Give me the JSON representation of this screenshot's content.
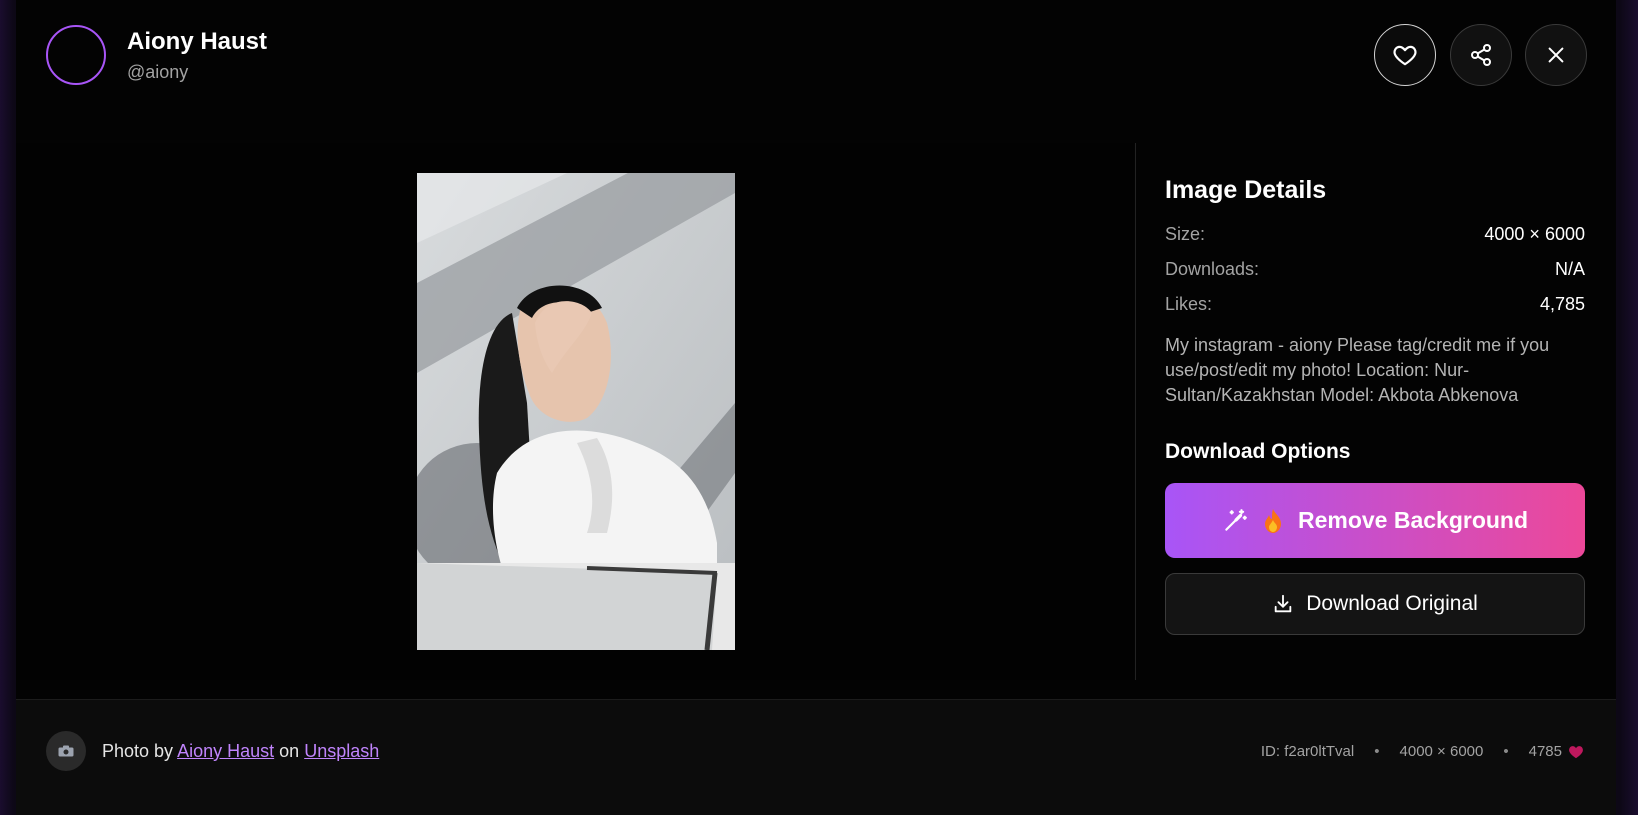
{
  "author": {
    "name": "Aiony Haust",
    "handle": "@aiony"
  },
  "details": {
    "title": "Image Details",
    "rows": [
      {
        "label": "Size:",
        "value": "4000 × 6000"
      },
      {
        "label": "Downloads:",
        "value": "N/A"
      },
      {
        "label": "Likes:",
        "value": "4,785"
      }
    ],
    "description": "My instagram - aiony Please tag/credit me if you use/post/edit my photo! Location: Nur-Sultan/Kazakhstan Model: Akbota Abkenova"
  },
  "download": {
    "title": "Download Options",
    "remove_bg_label": "Remove Background",
    "original_label": "Download Original"
  },
  "footer": {
    "photo_by": "Photo by",
    "author_link": "Aiony Haust",
    "on": "on",
    "source_link": "Unsplash",
    "id": "ID: f2ar0ltTval",
    "size": "4000 × 6000",
    "likes": "4785"
  },
  "icons": {
    "like": "heart-icon",
    "share": "share-icon",
    "close": "close-icon",
    "wand": "magic-wand-icon",
    "fire": "fire-icon",
    "download": "download-icon",
    "camera": "camera-icon"
  },
  "colors": {
    "accent_start": "#a855f7",
    "accent_end": "#ec4899",
    "link": "#c084fc"
  }
}
